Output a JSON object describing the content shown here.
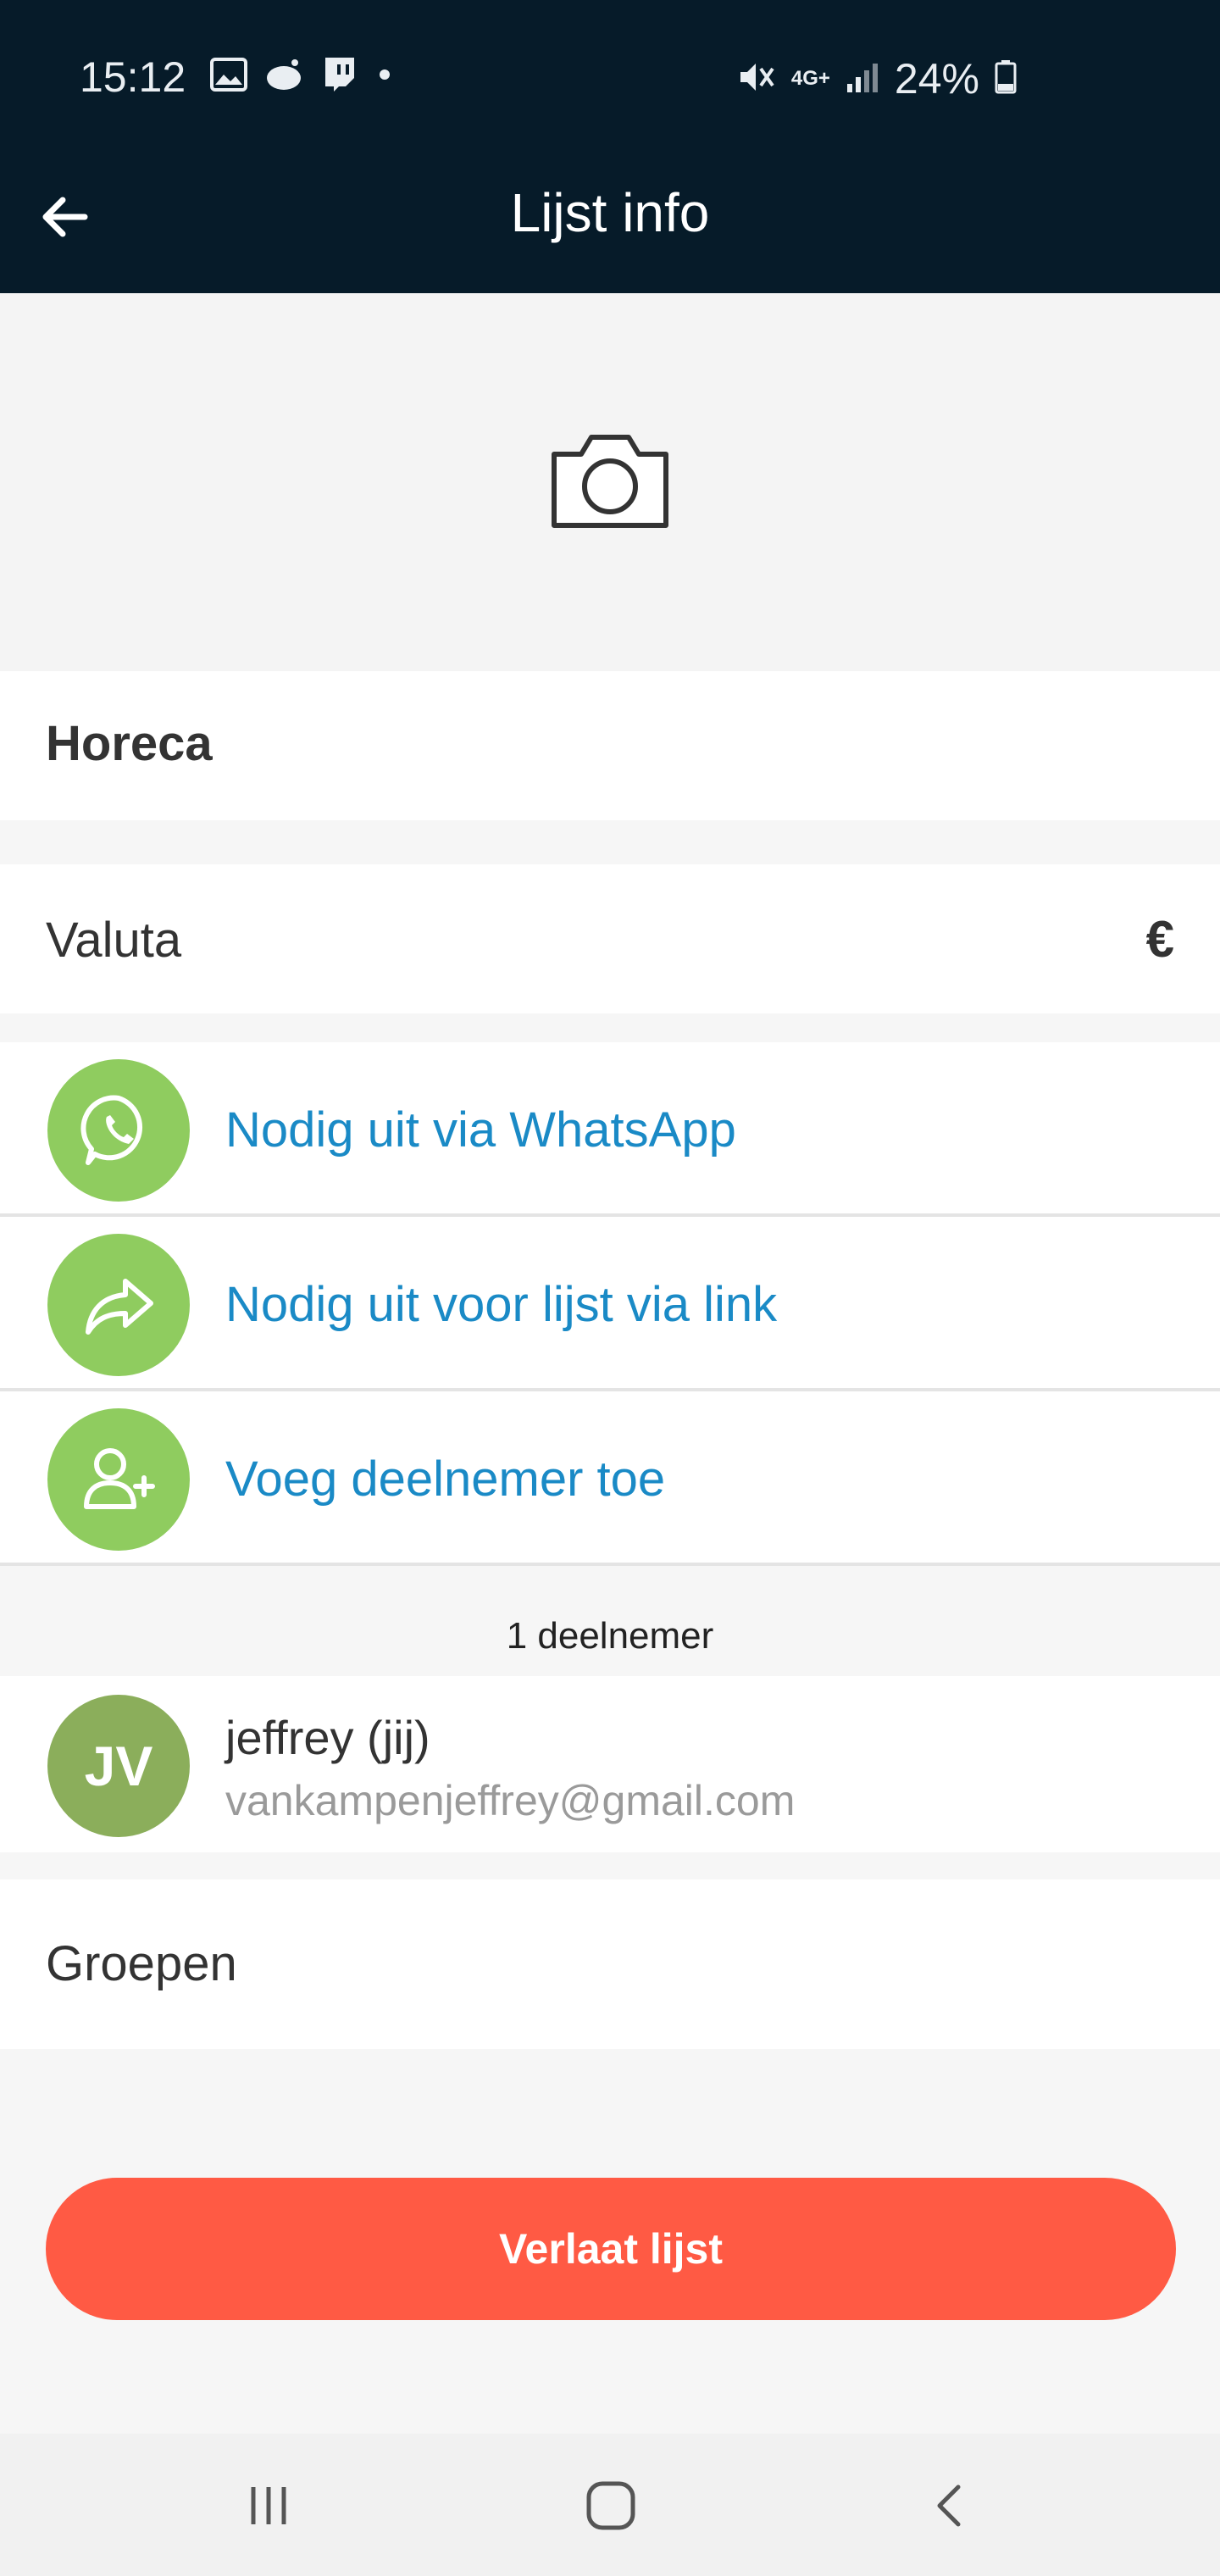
{
  "status_bar": {
    "time": "15:12",
    "battery": "24%",
    "network": "4G+",
    "icons": [
      "gallery-icon",
      "reddit-icon",
      "twitch-icon",
      "dot-icon",
      "mute-icon",
      "network-icon",
      "signal-icon",
      "battery-icon"
    ]
  },
  "appbar": {
    "title": "Lijst info",
    "back_icon": "arrow-left-icon"
  },
  "photo": {
    "icon": "camera-icon"
  },
  "list": {
    "name": "Horeca"
  },
  "currency": {
    "label": "Valuta",
    "value": "€"
  },
  "invites": [
    {
      "label": "Nodig uit via WhatsApp",
      "icon": "whatsapp-icon"
    },
    {
      "label": "Nodig uit voor lijst via link",
      "icon": "share-icon"
    },
    {
      "label": "Voeg deelnemer toe",
      "icon": "add-person-icon"
    }
  ],
  "participants": {
    "header": "1 deelnemer",
    "items": [
      {
        "initials": "JV",
        "name": "jeffrey (jij)",
        "email": "vankampenjeffrey@gmail.com"
      }
    ]
  },
  "groups": {
    "label": "Groepen"
  },
  "leave_button": {
    "label": "Verlaat lijst"
  },
  "colors": {
    "topbar": "#061b29",
    "accent_green": "#8fcc5f",
    "link_blue": "#1a8ac6",
    "leave_red": "#ff5a44"
  }
}
